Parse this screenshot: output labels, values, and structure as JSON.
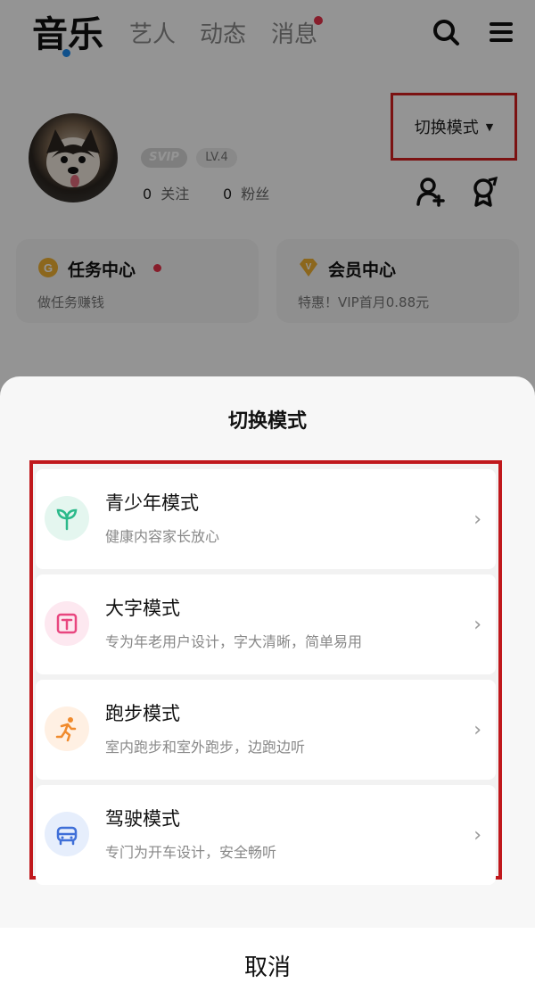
{
  "nav": {
    "tabs": [
      {
        "label": "音乐",
        "active": true
      },
      {
        "label": "艺人",
        "active": false
      },
      {
        "label": "动态",
        "active": false
      },
      {
        "label": "消息",
        "active": false,
        "badge_dot": true
      }
    ],
    "icons": [
      "search-icon",
      "menu-icon"
    ]
  },
  "profile": {
    "svip_badge": "SVIP",
    "level_badge": "LV.4",
    "follow_count": "0",
    "follow_label": "关注",
    "fans_count": "0",
    "fans_label": "粉丝",
    "mode_switch_label": "切换模式",
    "icons": [
      "add-friend-icon",
      "badge-icon"
    ]
  },
  "cards": [
    {
      "title": "任务中心",
      "subtitle": "做任务赚钱",
      "icon": "coin-icon",
      "red_dot": true
    },
    {
      "title": "会员中心",
      "subtitle": "特惠！VIP首月0.88元",
      "icon": "vip-diamond-icon"
    }
  ],
  "sheet": {
    "title": "切换模式",
    "options": [
      {
        "label": "青少年模式",
        "desc": "健康内容家长放心",
        "icon": "sprout-icon",
        "icon_bg": "#e4f6ef",
        "icon_color": "#2bb98a"
      },
      {
        "label": "大字模式",
        "desc": "专为年老用户设计，字大清晰，简单易用",
        "icon": "text-t-icon",
        "icon_bg": "#fde8f0",
        "icon_color": "#e8467f"
      },
      {
        "label": "跑步模式",
        "desc": "室内跑步和室外跑步，边跑边听",
        "icon": "runner-icon",
        "icon_bg": "#fff0e3",
        "icon_color": "#f08a2c"
      },
      {
        "label": "驾驶模式",
        "desc": "专门为开车设计，安全畅听",
        "icon": "car-icon",
        "icon_bg": "#e6eefc",
        "icon_color": "#3f6fd8"
      }
    ],
    "cancel_label": "取消"
  },
  "colors": {
    "highlight_border": "#c0181c",
    "accent_blue": "#1e8cf0",
    "notify_red": "#e8334a"
  }
}
